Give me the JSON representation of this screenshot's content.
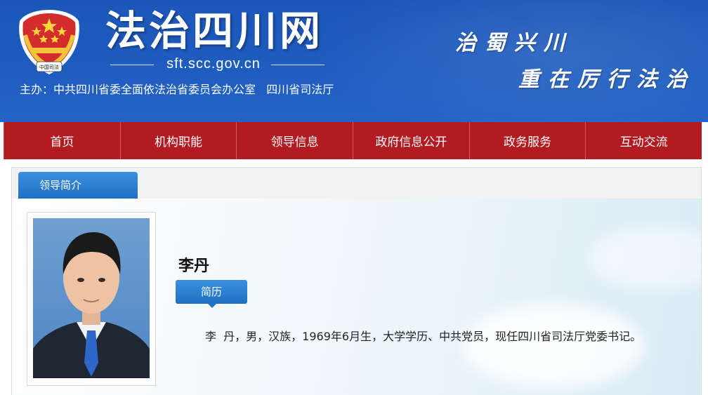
{
  "header": {
    "emblem_text": "中国司法",
    "title": "法治四川网",
    "domain": "sft.scc.gov.cn",
    "sponsor": "主办：中共四川省委全面依法治省委员会办公室   四川省司法厅",
    "slogan_line1": "治蜀兴川",
    "slogan_line2": "重在厉行法治"
  },
  "nav": {
    "items": [
      "首页",
      "机构职能",
      "领导信息",
      "政府信息公开",
      "政务服务",
      "互动交流"
    ]
  },
  "tab": {
    "label": "领导简介"
  },
  "leader": {
    "name": "李丹",
    "resume_button": "简历",
    "bio": "李  丹，男，汉族，1969年6月生，大学学历、中共党员，现任四川省司法厅党委书记。"
  },
  "colors": {
    "header_blue": "#1e5cbf",
    "nav_red": "#b21b21",
    "accent_blue": "#2474c8"
  }
}
